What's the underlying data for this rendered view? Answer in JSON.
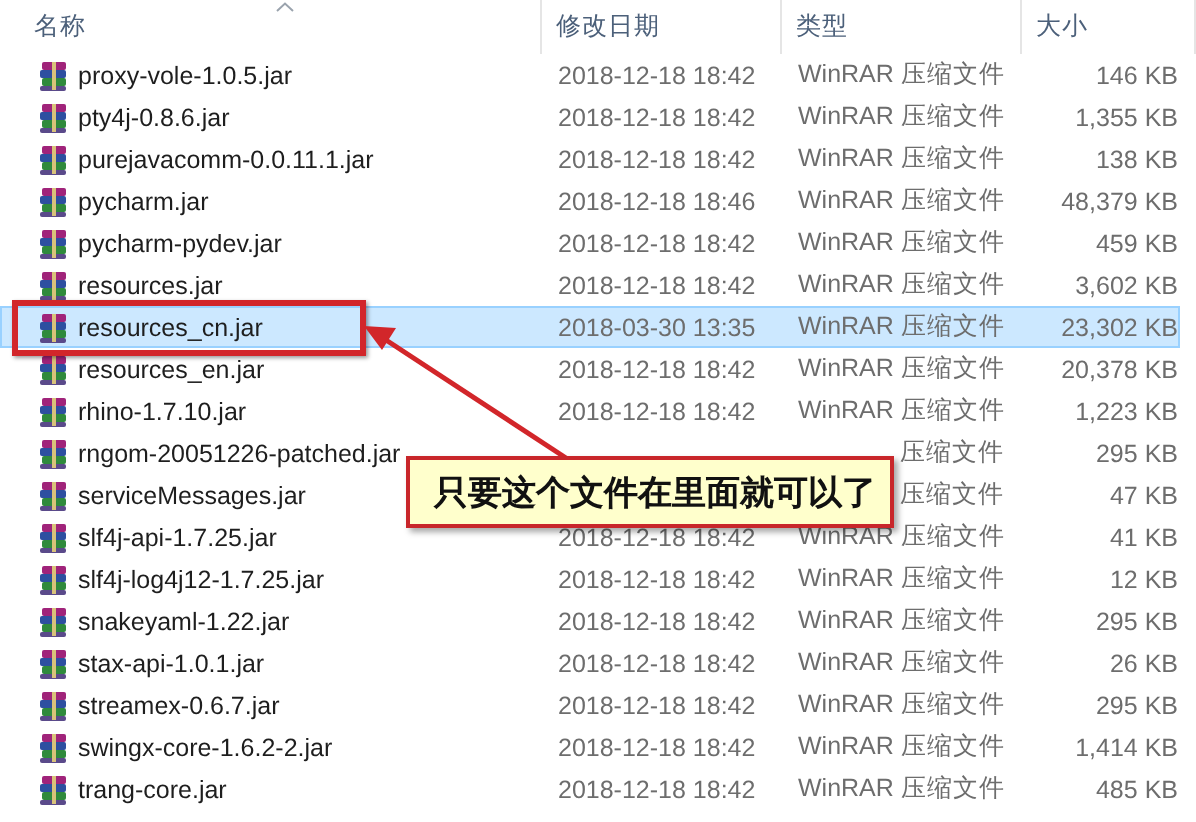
{
  "columns": [
    {
      "label": "名称",
      "sorted": true
    },
    {
      "label": "修改日期"
    },
    {
      "label": "类型"
    },
    {
      "label": "大小"
    }
  ],
  "rows": [
    {
      "name": "proxy-vole-1.0.5.jar",
      "date": "2018-12-18 18:42",
      "type": "WinRAR 压缩文件",
      "size": "146 KB",
      "selected": false,
      "highlighted": false
    },
    {
      "name": "pty4j-0.8.6.jar",
      "date": "2018-12-18 18:42",
      "type": "WinRAR 压缩文件",
      "size": "1,355 KB",
      "selected": false,
      "highlighted": false
    },
    {
      "name": "purejavacomm-0.0.11.1.jar",
      "date": "2018-12-18 18:42",
      "type": "WinRAR 压缩文件",
      "size": "138 KB",
      "selected": false,
      "highlighted": false
    },
    {
      "name": "pycharm.jar",
      "date": "2018-12-18 18:46",
      "type": "WinRAR 压缩文件",
      "size": "48,379 KB",
      "selected": false,
      "highlighted": false
    },
    {
      "name": "pycharm-pydev.jar",
      "date": "2018-12-18 18:42",
      "type": "WinRAR 压缩文件",
      "size": "459 KB",
      "selected": false,
      "highlighted": false
    },
    {
      "name": "resources.jar",
      "date": "2018-12-18 18:42",
      "type": "WinRAR 压缩文件",
      "size": "3,602 KB",
      "selected": false,
      "highlighted": false
    },
    {
      "name": "resources_cn.jar",
      "date": "2018-03-30 13:35",
      "type": "WinRAR 压缩文件",
      "size": "23,302 KB",
      "selected": true,
      "highlighted": true
    },
    {
      "name": "resources_en.jar",
      "date": "2018-12-18 18:42",
      "type": "WinRAR 压缩文件",
      "size": "20,378 KB",
      "selected": false,
      "highlighted": false
    },
    {
      "name": "rhino-1.7.10.jar",
      "date": "2018-12-18 18:42",
      "type": "WinRAR 压缩文件",
      "size": "1,223 KB",
      "selected": false,
      "highlighted": false
    },
    {
      "name": "rngom-20051226-patched.jar",
      "type_tail": "压缩文件",
      "size": "295 KB",
      "selected": false,
      "highlighted": false
    },
    {
      "name": "serviceMessages.jar",
      "type_tail": "压缩文件",
      "size": "47 KB",
      "selected": false,
      "highlighted": false
    },
    {
      "name": "slf4j-api-1.7.25.jar",
      "date": "2018-12-18 18:42",
      "type": "WinRAR 压缩文件",
      "size": "41 KB",
      "selected": false,
      "highlighted": false
    },
    {
      "name": "slf4j-log4j12-1.7.25.jar",
      "date": "2018-12-18 18:42",
      "type": "WinRAR 压缩文件",
      "size": "12 KB",
      "selected": false,
      "highlighted": false
    },
    {
      "name": "snakeyaml-1.22.jar",
      "date": "2018-12-18 18:42",
      "type": "WinRAR 压缩文件",
      "size": "295 KB",
      "selected": false,
      "highlighted": false
    },
    {
      "name": "stax-api-1.0.1.jar",
      "date": "2018-12-18 18:42",
      "type": "WinRAR 压缩文件",
      "size": "26 KB",
      "selected": false,
      "highlighted": false
    },
    {
      "name": "streamex-0.6.7.jar",
      "date": "2018-12-18 18:42",
      "type": "WinRAR 压缩文件",
      "size": "295 KB",
      "selected": false,
      "highlighted": false
    },
    {
      "name": "swingx-core-1.6.2-2.jar",
      "date": "2018-12-18 18:42",
      "type": "WinRAR 压缩文件",
      "size": "1,414 KB",
      "selected": false,
      "highlighted": false
    },
    {
      "name": "trang-core.jar",
      "date": "2018-12-18 18:42",
      "type": "WinRAR 压缩文件",
      "size": "485 KB",
      "selected": false,
      "highlighted": false
    }
  ],
  "callout": {
    "text": "只要这个文件在里面就可以了"
  }
}
